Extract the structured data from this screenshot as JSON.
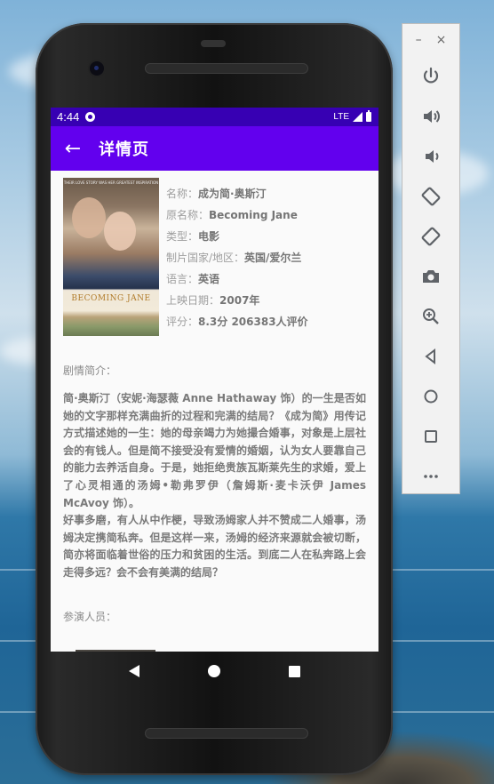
{
  "status_bar": {
    "time": "4:44",
    "network": "LTE"
  },
  "app_bar": {
    "title": "详情页"
  },
  "movie": {
    "poster_title": "BECOMING JANE",
    "poster_tagline": "THEIR LOVE STORY WAS HER GREATEST INSPIRATION",
    "fields": [
      {
        "label": "名称：",
        "value": "成为简·奥斯汀"
      },
      {
        "label": "原名称：",
        "value": "Becoming Jane"
      },
      {
        "label": "类型：",
        "value": "电影"
      },
      {
        "label": "制片国家/地区：",
        "value": "英国/爱尔兰"
      },
      {
        "label": "语言：",
        "value": "英语"
      },
      {
        "label": "上映日期：",
        "value": "2007年"
      },
      {
        "label": "评分：",
        "value": "8.3分  206383人评价"
      }
    ]
  },
  "synopsis": {
    "title": "剧情简介：",
    "text": "简·奥斯汀（安妮·海瑟薇 Anne Hathaway 饰）的一生是否如她的文字那样充满曲折的过程和完满的结局？《成为简》用传记方式描述她的一生：她的母亲竭力为她撮合婚事，对象是上层社会的有钱人。但是简不接受没有爱情的婚姻，认为女人要靠自己的能力去养活自身。于是，她拒绝贵族瓦斯莱先生的求婚，爱上了心灵相通的汤姆•勒弗罗伊（詹姆斯·麦卡沃伊 James McAvoy 饰）。\n好事多磨，有人从中作梗，导致汤姆家人并不赞成二人婚事，汤姆决定携简私奔。但是这样一来，汤姆的经济来源就会被切断，简亦将面临着世俗的压力和贫困的生活。到底二人在私奔路上会走得多远？会不会有美满的结局？"
  },
  "cast": {
    "title": "参演人员："
  },
  "emulator_panel": {
    "minimize": "–",
    "close": "×",
    "tools": [
      "power-icon",
      "volume-up-icon",
      "volume-down-icon",
      "rotate-left-icon",
      "rotate-right-icon",
      "camera-icon",
      "zoom-icon",
      "back-icon",
      "home-icon",
      "overview-icon",
      "more-icon"
    ]
  },
  "colors": {
    "status_bar": "#3700b3",
    "app_bar": "#6200ee"
  }
}
